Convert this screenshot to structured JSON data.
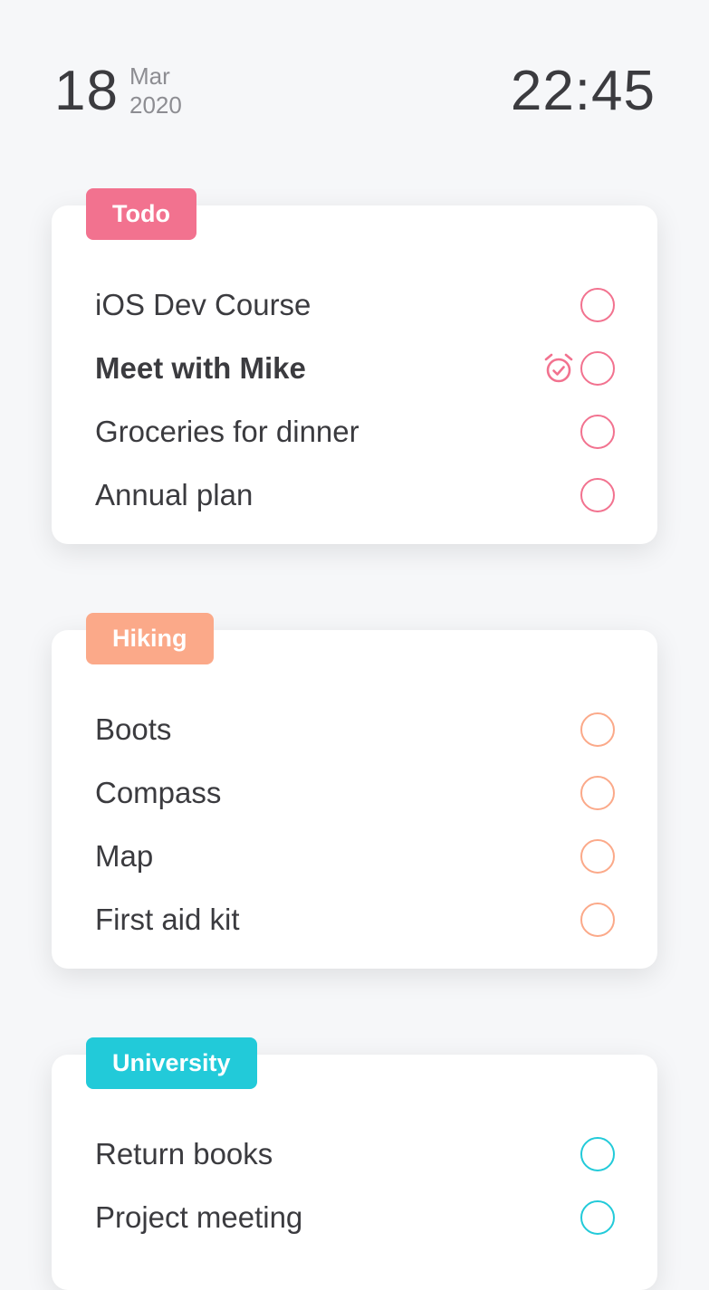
{
  "header": {
    "day": "18",
    "month": "Mar",
    "year": "2020",
    "time": "22:45"
  },
  "colors": {
    "todo": "#f2728f",
    "hiking": "#fba989",
    "university": "#22cad9",
    "background": "#f6f7f9",
    "text": "#3b3b3f"
  },
  "lists": [
    {
      "title": "Todo",
      "items": [
        {
          "label": "iOS Dev Course",
          "checked": false
        },
        {
          "label": "Meet with Mike",
          "checked": false,
          "bold": true,
          "alarm_icon": "alarm-clock-icon"
        },
        {
          "label": "Groceries for dinner",
          "checked": false
        },
        {
          "label": "Annual plan",
          "checked": false
        }
      ]
    },
    {
      "title": "Hiking",
      "items": [
        {
          "label": "Boots",
          "checked": false
        },
        {
          "label": "Compass",
          "checked": false
        },
        {
          "label": "Map",
          "checked": false
        },
        {
          "label": "First aid kit",
          "checked": false
        }
      ]
    },
    {
      "title": "University",
      "items": [
        {
          "label": "Return books",
          "checked": false
        },
        {
          "label": "Project meeting",
          "checked": false
        }
      ]
    }
  ]
}
